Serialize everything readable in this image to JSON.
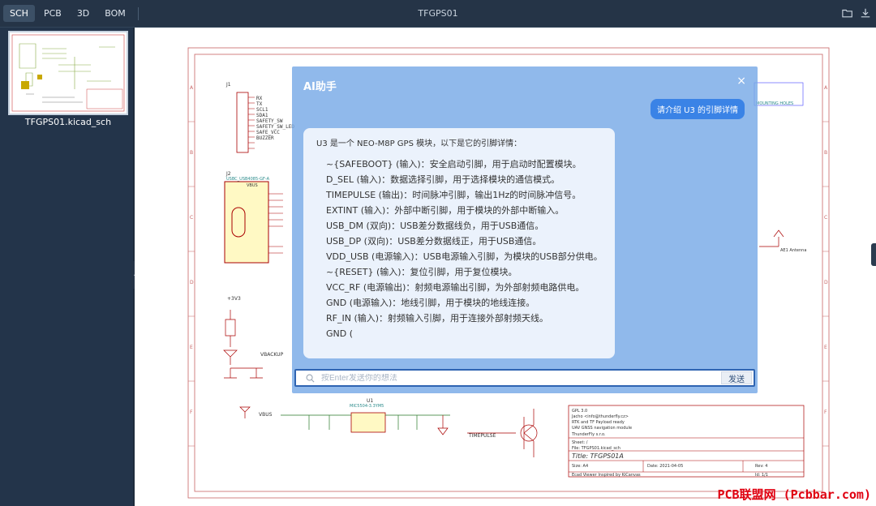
{
  "topbar": {
    "tabs": [
      "SCH",
      "PCB",
      "3D",
      "BOM"
    ],
    "active_tab": "SCH",
    "title": "TFGPS01"
  },
  "sidebar": {
    "thumbnail_label": "TFGPS01.kicad_sch"
  },
  "schematic": {
    "j1_label": "J1",
    "j1_pins": [
      "RX",
      "TX",
      "SCL1",
      "SDA1",
      "SAFETY_SW",
      "SAFETY_SW_LED",
      "SAFE_VCC",
      "BUZZER"
    ],
    "j2_label": "J2",
    "j2_part": "USBC_USB4085-GF-A",
    "vbus_label": "VBUS",
    "vbackup_label": "VBACKUP",
    "v33_label": "+3V3",
    "timepulse_label": "TIMEPULSE",
    "u1_label": "U1",
    "u1_part": "MIC5504-3.3YM5",
    "antenna_label": "AE1 Antenna",
    "mounting_label": "MOUNTING HOLES",
    "title_block": {
      "license": "GPL 3.0",
      "author": "Jacho <info@thunderfly.cz>",
      "desc1": "RTK and TF Payload ready",
      "desc2": "UAV GNSS navigation module",
      "company": "ThunderFly s.r.o.",
      "sheet": "Sheet: /",
      "file": "File: TFGPS01.kicad_sch",
      "title": "Title: TFGPS01A",
      "size": "Size: A4",
      "date": "Date: 2021-04-05",
      "rev": "Rev: 4",
      "viewer": "Ecad Viewer Inspired by KiCanvas",
      "id": "Id: 1/1"
    }
  },
  "ai_panel": {
    "title": "AI助手",
    "close": "×",
    "user_message": "请介绍 U3 的引脚详情",
    "answer_intro": "U3 是一个 NEO-M8P GPS 模块，以下是它的引脚详情：",
    "answer_lines": [
      "~{SAFEBOOT} (输入)：安全启动引脚，用于启动时配置模块。",
      "D_SEL (输入)：数据选择引脚，用于选择模块的通信模式。",
      "TIMEPULSE (输出)：时间脉冲引脚，输出1Hz的时间脉冲信号。",
      "EXTINT (输入)：外部中断引脚，用于模块的外部中断输入。",
      "USB_DM (双向)：USB差分数据线负，用于USB通信。",
      "USB_DP (双向)：USB差分数据线正，用于USB通信。",
      "VDD_USB (电源输入)：USB电源输入引脚，为模块的USB部分供电。",
      "~{RESET} (输入)：复位引脚，用于复位模块。",
      "VCC_RF (电源输出)：射频电源输出引脚，为外部射频电路供电。",
      "GND (电源输入)：地线引脚，用于模块的地线连接。",
      "RF_IN (输入)：射频输入引脚，用于连接外部射频天线。",
      "GND ("
    ],
    "input_placeholder": "按Enter发送你的想法",
    "send_label": "发送"
  },
  "watermark": "PCB联盟网 (Pcbbar.com)"
}
